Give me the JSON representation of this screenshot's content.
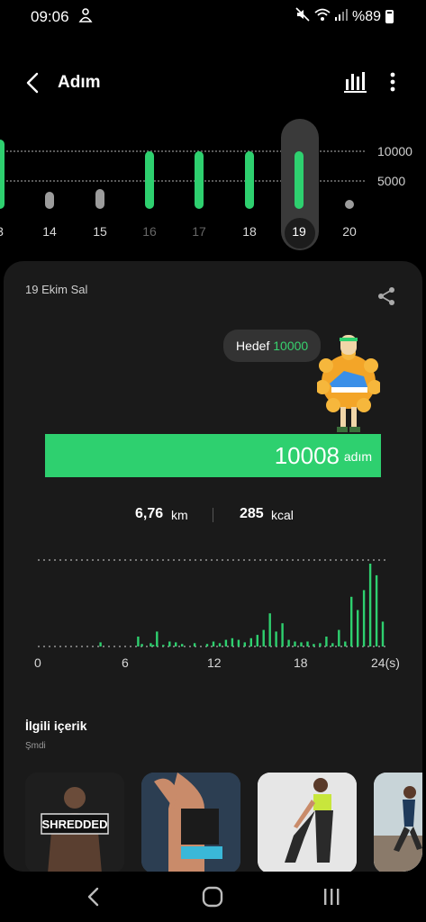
{
  "status_bar": {
    "time": "09:06",
    "battery": "%89"
  },
  "app_bar": {
    "title": "Adım"
  },
  "week": {
    "grid": [
      {
        "label": "10000"
      },
      {
        "label": "5000"
      }
    ],
    "days": [
      {
        "label": "3",
        "steps": 12000,
        "state": "past"
      },
      {
        "label": "14",
        "steps": 3000,
        "state": "past"
      },
      {
        "label": "15",
        "steps": 3500,
        "state": "past"
      },
      {
        "label": "16",
        "steps": 10000,
        "state": "dim"
      },
      {
        "label": "17",
        "steps": 10000,
        "state": "dim"
      },
      {
        "label": "18",
        "steps": 10000,
        "state": "past"
      },
      {
        "label": "19",
        "steps": 10008,
        "state": "selected"
      },
      {
        "label": "20",
        "steps": 0,
        "state": "future"
      }
    ],
    "colors": {
      "goal_met": "#2ed06f",
      "below_goal": "#9c9c9c"
    }
  },
  "detail": {
    "date": "19 Ekim Sal",
    "goal_label": "Hedef",
    "goal_value": "10000",
    "steps": "10008",
    "steps_unit": "adım",
    "progress_fraction": 1.0,
    "distance": "6,76",
    "distance_unit": "km",
    "calories": "285",
    "calories_unit": "kcal"
  },
  "hourly_chart": {
    "hour_labels": [
      "0",
      "6",
      "12",
      "18",
      "24(s)"
    ],
    "bars": [
      {
        "hour": 5.0,
        "value": 5
      },
      {
        "hour": 8.0,
        "value": 12
      },
      {
        "hour": 8.3,
        "value": 3
      },
      {
        "hour": 9.0,
        "value": 4
      },
      {
        "hour": 9.2,
        "value": 2
      },
      {
        "hour": 9.5,
        "value": 18
      },
      {
        "hour": 10.0,
        "value": 2
      },
      {
        "hour": 10.5,
        "value": 6
      },
      {
        "hour": 11.0,
        "value": 5
      },
      {
        "hour": 11.5,
        "value": 3
      },
      {
        "hour": 12.5,
        "value": 4
      },
      {
        "hour": 13.5,
        "value": 3
      },
      {
        "hour": 14.0,
        "value": 6
      },
      {
        "hour": 14.5,
        "value": 4
      },
      {
        "hour": 15.0,
        "value": 8
      },
      {
        "hour": 15.5,
        "value": 10
      },
      {
        "hour": 16.0,
        "value": 8
      },
      {
        "hour": 16.5,
        "value": 5
      },
      {
        "hour": 17.0,
        "value": 10
      },
      {
        "hour": 17.5,
        "value": 14
      },
      {
        "hour": 18.0,
        "value": 20
      },
      {
        "hour": 18.5,
        "value": 40
      },
      {
        "hour": 19.0,
        "value": 18
      },
      {
        "hour": 19.5,
        "value": 28
      },
      {
        "hour": 20.0,
        "value": 8
      },
      {
        "hour": 20.5,
        "value": 6
      },
      {
        "hour": 21.0,
        "value": 5
      },
      {
        "hour": 21.5,
        "value": 6
      },
      {
        "hour": 22.0,
        "value": 3
      },
      {
        "hour": 22.5,
        "value": 4
      },
      {
        "hour": 23.0,
        "value": 12
      },
      {
        "hour": 23.5,
        "value": 4
      },
      {
        "hour": 24.0,
        "value": 20
      },
      {
        "hour": 24.5,
        "value": 6
      },
      {
        "hour": 25.0,
        "value": 60
      },
      {
        "hour": 25.5,
        "value": 44
      },
      {
        "hour": 26.0,
        "value": 68
      },
      {
        "hour": 26.5,
        "value": 100
      },
      {
        "hour": 27.0,
        "value": 86
      },
      {
        "hour": 27.5,
        "value": 30
      }
    ],
    "max_hour": 28,
    "color": "#2ed06f"
  },
  "related": {
    "title": "İlgili içerik",
    "subtitle": "Şmdi",
    "items": [
      {
        "logo_text": "SHREDDED",
        "kind": "workout-shredded"
      },
      {
        "logo_text": "",
        "kind": "workout-back"
      },
      {
        "logo_text": "",
        "kind": "workout-stretch"
      },
      {
        "logo_text": "",
        "kind": "workout-run"
      }
    ]
  },
  "icons": {
    "back": "chevron-left-icon",
    "chart": "bar-chart-icon",
    "more": "more-vertical-icon",
    "share": "share-icon",
    "nav_back": "nav-back-icon",
    "nav_home": "nav-home-icon",
    "nav_recents": "nav-recents-icon"
  }
}
